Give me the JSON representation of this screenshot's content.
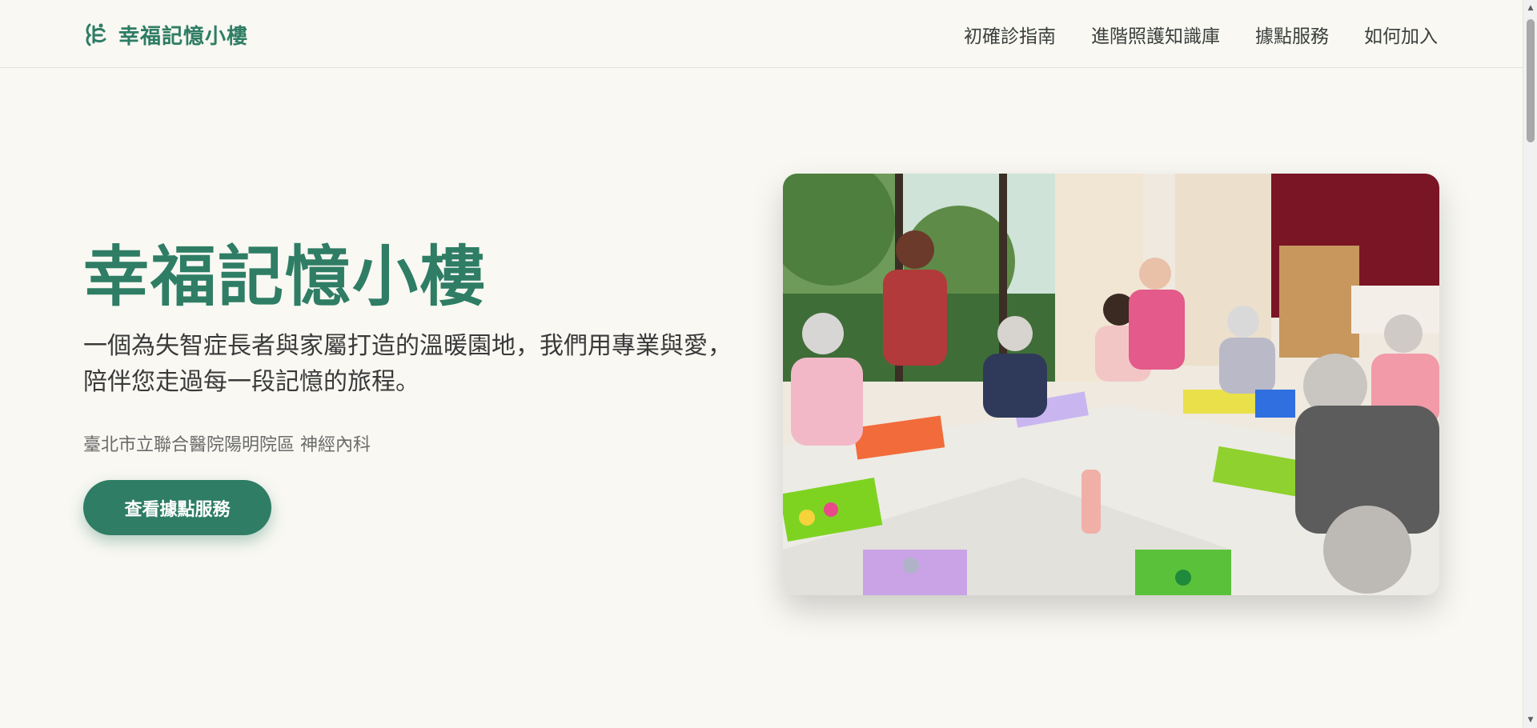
{
  "brand": {
    "name": "幸福記憶小樓",
    "color": "#2e7d64"
  },
  "nav": {
    "items": [
      {
        "label": "初確診指南"
      },
      {
        "label": "進階照護知識庫"
      },
      {
        "label": "據點服務"
      },
      {
        "label": "如何加入"
      }
    ]
  },
  "hero": {
    "title": "幸福記憶小樓",
    "description": "一個為失智症長者與家屬打造的溫暖園地，我們用專業與愛，陪伴您走過每一段記憶的旅程。",
    "organization": "臺北市立聯合醫院陽明院區 神經內科",
    "cta_label": "查看據點服務",
    "image_alt": "長者們圍坐桌邊進行美勞手作活動"
  },
  "colors": {
    "accent": "#2e7d64",
    "background": "#f9f8f3"
  },
  "icons": {
    "brand": "memory-leaf-icon",
    "scroll_up": "triangle-up-icon",
    "scroll_down": "triangle-down-icon"
  }
}
